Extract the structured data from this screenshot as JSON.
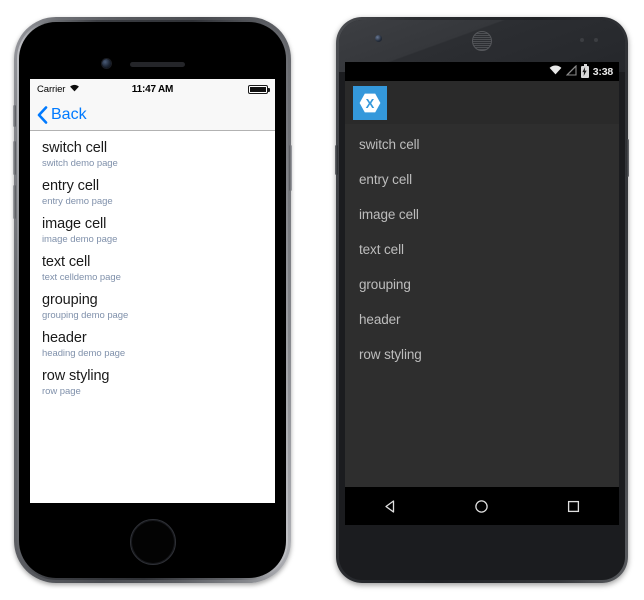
{
  "ios": {
    "status_bar": {
      "carrier": "Carrier",
      "wifi_icon": "wifi-icon",
      "time": "11:47 AM",
      "battery_icon": "battery-full-icon"
    },
    "nav_bar": {
      "back_icon": "chevron-left-icon",
      "back_label": "Back"
    },
    "list": [
      {
        "title": "switch cell",
        "detail": "switch demo page"
      },
      {
        "title": "entry cell",
        "detail": "entry demo page"
      },
      {
        "title": "image cell",
        "detail": "image demo page"
      },
      {
        "title": "text cell",
        "detail": "text celldemo page"
      },
      {
        "title": "grouping",
        "detail": "grouping demo page"
      },
      {
        "title": "header",
        "detail": "heading demo page"
      },
      {
        "title": "row styling",
        "detail": "row page"
      }
    ],
    "hardware": {
      "camera_icon": "front-camera-icon",
      "speaker_icon": "earpiece-speaker-icon",
      "home_button": "home-button",
      "volume_up": "volume-up-button",
      "volume_down": "volume-down-button",
      "mute_switch": "mute-switch",
      "power_button": "power-button"
    },
    "colors": {
      "tint": "#007AFF",
      "detail_text": "#8091AB",
      "bar_background": "#F8F8F8",
      "screen_background": "#FFFFFF"
    }
  },
  "android": {
    "status_bar": {
      "wifi_icon": "wifi-icon",
      "signal_icon": "cell-signal-icon",
      "battery_icon": "battery-charging-icon",
      "time": "3:38"
    },
    "action_bar": {
      "app_icon": "xamarin-logo-icon",
      "app_icon_glyph": "X"
    },
    "list": [
      {
        "title": "switch cell"
      },
      {
        "title": "entry cell"
      },
      {
        "title": "image cell"
      },
      {
        "title": "text cell"
      },
      {
        "title": "grouping"
      },
      {
        "title": "header"
      },
      {
        "title": "row styling"
      }
    ],
    "nav_bar": {
      "back_icon": "nav-back-icon",
      "home_icon": "nav-home-icon",
      "recents_icon": "nav-recents-icon"
    },
    "hardware": {
      "camera_icon": "front-camera-icon",
      "speaker_icon": "earpiece-speaker-icon",
      "sensor_icon": "proximity-sensor-icon",
      "power_button": "power-button",
      "volume_button": "volume-button"
    },
    "colors": {
      "accent": "#3498DB",
      "action_bar_background": "#2A2A2A",
      "screen_background": "#2E2E2E",
      "list_text": "#BDBDBD",
      "system_bar": "#000000"
    }
  }
}
